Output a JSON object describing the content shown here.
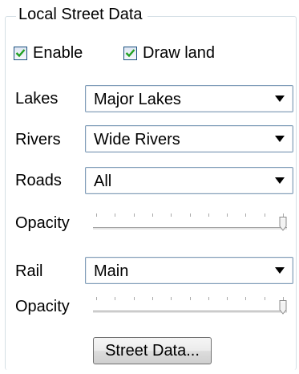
{
  "group": {
    "title": "Local Street Data"
  },
  "checkboxes": {
    "enable": {
      "label": "Enable",
      "checked": true
    },
    "draw_land": {
      "label": "Draw land",
      "checked": true
    }
  },
  "lakes": {
    "label": "Lakes",
    "value": "Major Lakes"
  },
  "rivers": {
    "label": "Rivers",
    "value": "Wide Rivers"
  },
  "roads": {
    "label": "Roads",
    "value": "All"
  },
  "roads_opacity": {
    "label": "Opacity",
    "level": 1.0
  },
  "rail": {
    "label": "Rail",
    "value": "Main"
  },
  "rail_opacity": {
    "label": "Opacity",
    "level": 1.0
  },
  "street_data_button": {
    "label": "Street Data..."
  },
  "colors": {
    "accent": "#1c5180",
    "border": "#7f9db9"
  }
}
